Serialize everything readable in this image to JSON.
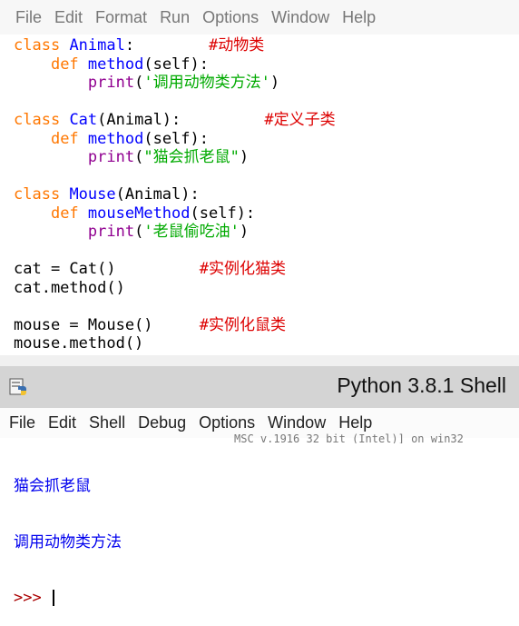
{
  "editor": {
    "menu": [
      "File",
      "Edit",
      "Format",
      "Run",
      "Options",
      "Window",
      "Help"
    ]
  },
  "code": {
    "l1_kw": "class",
    "l1_name": "Animal",
    "l1_rest": ":",
    "l1_comment": "#动物类",
    "l2_kw": "def",
    "l2_name": "method",
    "l2_rest": "(self):",
    "l3_fn": "print",
    "l3_open": "(",
    "l3_str": "'调用动物类方法'",
    "l3_close": ")",
    "l5_kw": "class",
    "l5_name": "Cat",
    "l5_rest": "(Animal):",
    "l5_comment": "#定义子类",
    "l6_kw": "def",
    "l6_name": "method",
    "l6_rest": "(self):",
    "l7_fn": "print",
    "l7_open": "(",
    "l7_str": "\"猫会抓老鼠\"",
    "l7_close": ")",
    "l9_kw": "class",
    "l9_name": "Mouse",
    "l9_rest": "(Animal):",
    "l10_kw": "def",
    "l10_name": "mouseMethod",
    "l10_rest": "(self):",
    "l11_fn": "print",
    "l11_open": "(",
    "l11_str": "'老鼠偷吃油'",
    "l11_close": ")",
    "l13_code": "cat = Cat()",
    "l13_comment": "#实例化猫类",
    "l14_code": "cat.method()",
    "l16_code": "mouse = Mouse()",
    "l16_comment": "#实例化鼠类",
    "l17_code": "mouse.method()"
  },
  "shell_window": {
    "title": "Python 3.8.1 Shell",
    "icon": "python-icon",
    "menu": [
      "File",
      "Edit",
      "Shell",
      "Debug",
      "Options",
      "Window",
      "Help"
    ],
    "hidden_text": "MSC v.1916 32 bit (Intel)] on win32",
    "output": [
      "猫会抓老鼠",
      "调用动物类方法"
    ],
    "prompt": ">>>"
  }
}
